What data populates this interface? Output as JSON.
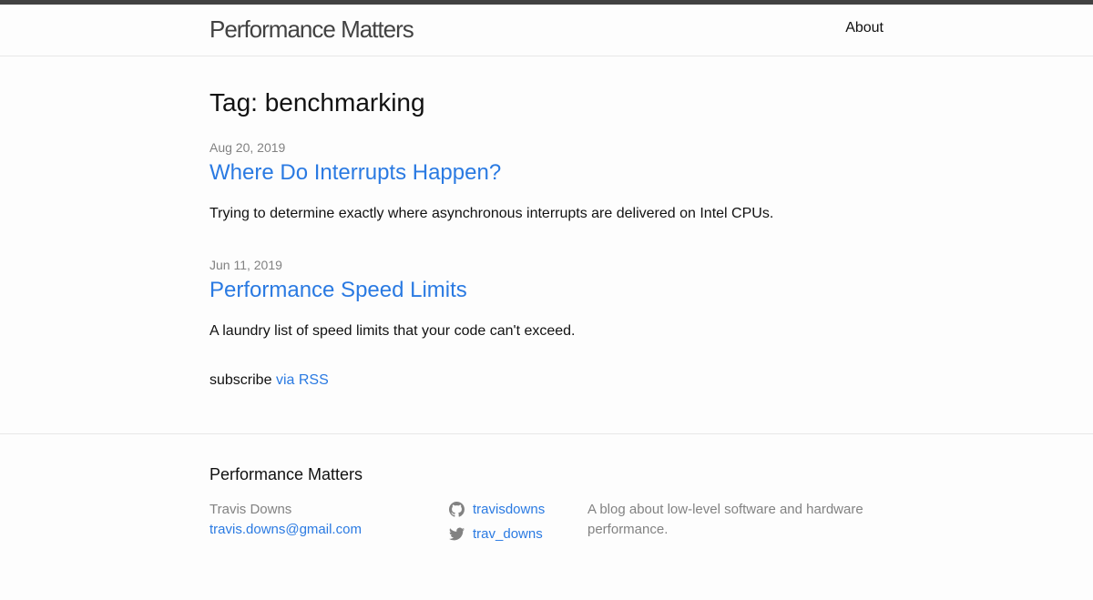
{
  "header": {
    "site_title": "Performance Matters",
    "nav": [
      {
        "label": "About"
      }
    ]
  },
  "main": {
    "page_heading": "Tag: benchmarking",
    "posts": [
      {
        "date": "Aug 20, 2019",
        "title": "Where Do Interrupts Happen?",
        "excerpt": "Trying to determine exactly where asynchronous interrupts are delivered on Intel CPUs."
      },
      {
        "date": "Jun 11, 2019",
        "title": "Performance Speed Limits",
        "excerpt": "A laundry list of speed limits that your code can't exceed."
      }
    ],
    "subscribe": {
      "text": "subscribe",
      "link_label": "via RSS"
    }
  },
  "footer": {
    "heading": "Performance Matters",
    "author": "Travis Downs",
    "email": "travis.downs@gmail.com",
    "social": [
      {
        "icon": "github-icon",
        "label": "travisdowns"
      },
      {
        "icon": "twitter-icon",
        "label": "trav_downs"
      }
    ],
    "description": "A blog about low-level software and hardware performance."
  },
  "colors": {
    "link": "#2a7ae2",
    "meta": "#828282",
    "topbar": "#424242"
  }
}
